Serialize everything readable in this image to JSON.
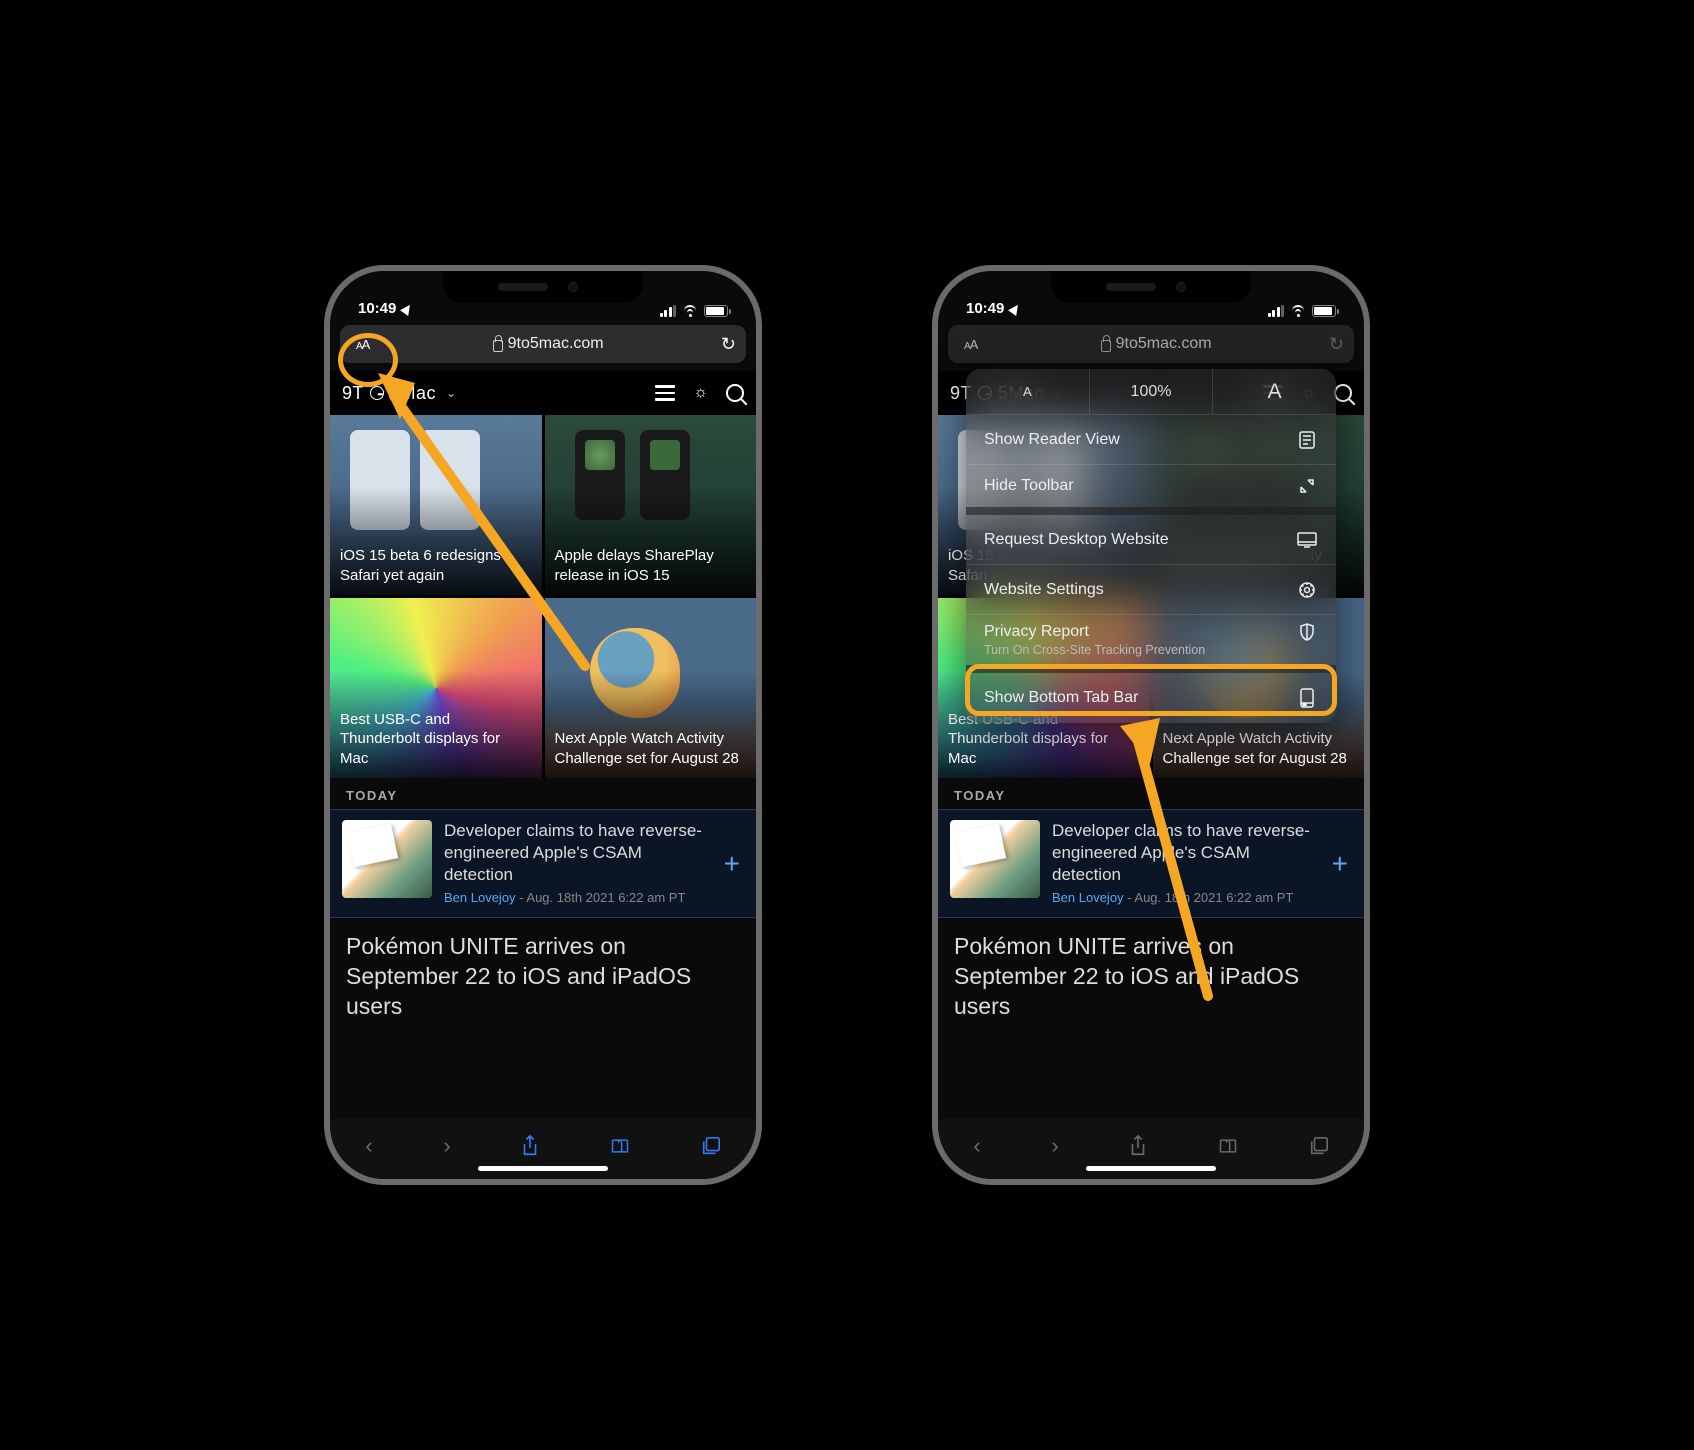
{
  "status": {
    "time": "10:49"
  },
  "url": {
    "domain": "9to5mac.com"
  },
  "site": {
    "logo_prefix": "9T",
    "logo_suffix": "5Mac"
  },
  "tiles": [
    "iOS 15 beta 6 redesigns Safari yet again",
    "Apple delays SharePlay release in iOS 15",
    "Best USB-C and Thunderbolt displays for Mac",
    "Next Apple Watch Activity Challenge set for August 28"
  ],
  "today": {
    "label": "TODAY"
  },
  "feature": {
    "title": "Developer claims to have reverse-engineered Apple's CSAM detection",
    "author": "Ben Lovejoy",
    "meta_suffix": " - Aug. 18th 2021 6:22 am PT"
  },
  "big_story": "Pokémon UNITE arrives on September 22 to iOS and iPadOS users",
  "popover": {
    "zoom": "100%",
    "reader": "Show Reader View",
    "hide": "Hide Toolbar",
    "desktop": "Request Desktop Website",
    "settings": "Website Settings",
    "privacy": "Privacy Report",
    "privacy_sub": "Turn On Cross-Site Tracking Prevention",
    "bottom": "Show Bottom Tab Bar"
  }
}
